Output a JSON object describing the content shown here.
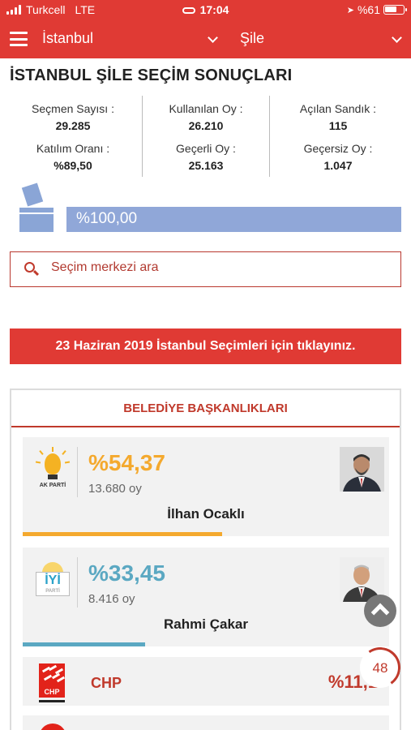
{
  "status_bar": {
    "carrier": "Turkcell",
    "network": "LTE",
    "time": "17:04",
    "battery": "%61"
  },
  "nav": {
    "city": "İstanbul",
    "district": "Şile"
  },
  "page_title": "İSTANBUL ŞİLE SEÇİM SONUÇLARI",
  "stats": [
    {
      "label": "Seçmen Sayısı :",
      "value": "29.285"
    },
    {
      "label": "Katılım Oranı :",
      "value": "%89,50"
    },
    {
      "label": "Kullanılan Oy :",
      "value": "26.210"
    },
    {
      "label": "Geçerli Oy :",
      "value": "25.163"
    },
    {
      "label": "Açılan Sandık :",
      "value": "115"
    },
    {
      "label": "Geçersiz Oy :",
      "value": "1.047"
    }
  ],
  "progress": {
    "label": "%100,00",
    "fraction": 1.0
  },
  "search": {
    "placeholder": "Seçim merkezi ara"
  },
  "banner": "23 Haziran 2019 İstanbul Seçimleri için tıklayınız.",
  "section_title": "BELEDİYE BAŞKANLIKLARI",
  "candidates": [
    {
      "party": "AK PARTİ",
      "percent": "%54,37",
      "votes": "13.680 oy",
      "name": "İlhan Ocaklı",
      "color": "#f4a92e",
      "share": 0.5437
    },
    {
      "party": "İYİ",
      "party_sub": "PARTİ",
      "percent": "%33,45",
      "votes": "8.416 oy",
      "name": "Rahmi Çakar",
      "color": "#5ba8c2",
      "share": 0.3345
    }
  ],
  "parties": [
    {
      "logo_text": "CHP",
      "name": "CHP",
      "percent": "%11,1",
      "color": "#c0392b"
    }
  ],
  "floating": {
    "counter": "48"
  },
  "icons": {
    "menu": "hamburger-icon",
    "search": "search-icon",
    "scroll_top": "chevron-up-icon",
    "ballot": "ballot-box-icon"
  }
}
